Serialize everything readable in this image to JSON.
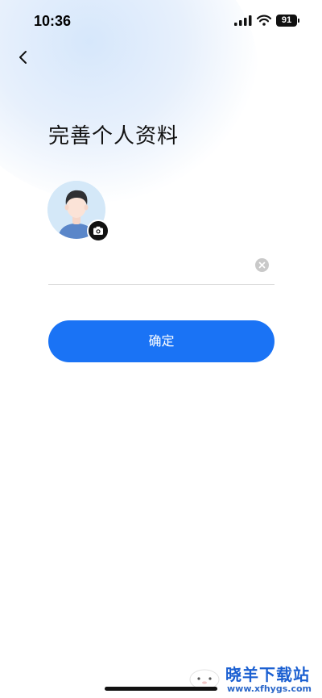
{
  "status_bar": {
    "time": "10:36",
    "battery": "91",
    "icons": [
      "signal-icon",
      "wifi-icon",
      "battery-icon"
    ]
  },
  "nav": {
    "back_icon": "chevron-left-icon"
  },
  "page": {
    "title": "完善个人资料"
  },
  "avatar": {
    "icon": "user-avatar",
    "badge_icon": "camera-icon"
  },
  "form": {
    "name_value": "",
    "name_placeholder": "",
    "clear_icon": "clear-icon"
  },
  "actions": {
    "confirm_label": "确定"
  },
  "watermark": {
    "title": "晓羊下载站",
    "url": "www.xfhygs.com"
  },
  "colors": {
    "primary": "#1a73f5",
    "background": "#ffffff",
    "glow": "#d6e7fb",
    "avatar_bg": "#d4e8f8",
    "watermark_blue": "#1a5fd1"
  }
}
